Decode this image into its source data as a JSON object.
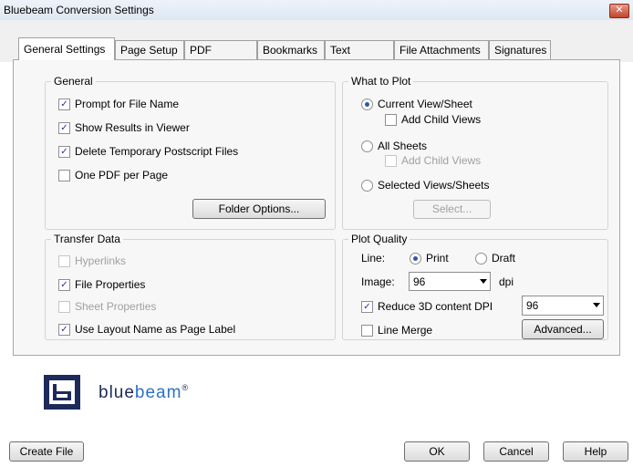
{
  "window": {
    "title": "Bluebeam Conversion Settings",
    "close": "✕"
  },
  "tabs": [
    "General Settings",
    "Page Setup",
    "PDF Security",
    "Bookmarks",
    "Text Stamps",
    "File Attachments",
    "Signatures"
  ],
  "general": {
    "legend": "General",
    "prompt_file_name": "Prompt for File Name",
    "show_results": "Show Results in Viewer",
    "delete_temp": "Delete Temporary Postscript Files",
    "one_pdf": "One PDF per Page",
    "folder_options": "Folder Options..."
  },
  "transfer": {
    "legend": "Transfer Data",
    "hyperlinks": "Hyperlinks",
    "file_properties": "File Properties",
    "sheet_properties": "Sheet Properties",
    "layout_name": "Use Layout Name as Page Label"
  },
  "what_to_plot": {
    "legend": "What to Plot",
    "current_view": "Current View/Sheet",
    "add_child_1": "Add Child Views",
    "all_sheets": "All Sheets",
    "add_child_2": "Add Child Views",
    "selected_views": "Selected Views/Sheets",
    "select_btn": "Select..."
  },
  "plot_quality": {
    "legend": "Plot Quality",
    "line_label": "Line:",
    "print": "Print",
    "draft": "Draft",
    "image_label": "Image:",
    "image_value": "96",
    "dpi": "dpi",
    "reduce_3d": "Reduce 3D content DPI",
    "reduce_value": "96",
    "line_merge": "Line Merge",
    "advanced": "Advanced..."
  },
  "brand": {
    "part1": "blue",
    "part2": "beam",
    "reg": "®"
  },
  "footer": {
    "create_file": "Create File",
    "ok": "OK",
    "cancel": "Cancel",
    "help": "Help"
  }
}
